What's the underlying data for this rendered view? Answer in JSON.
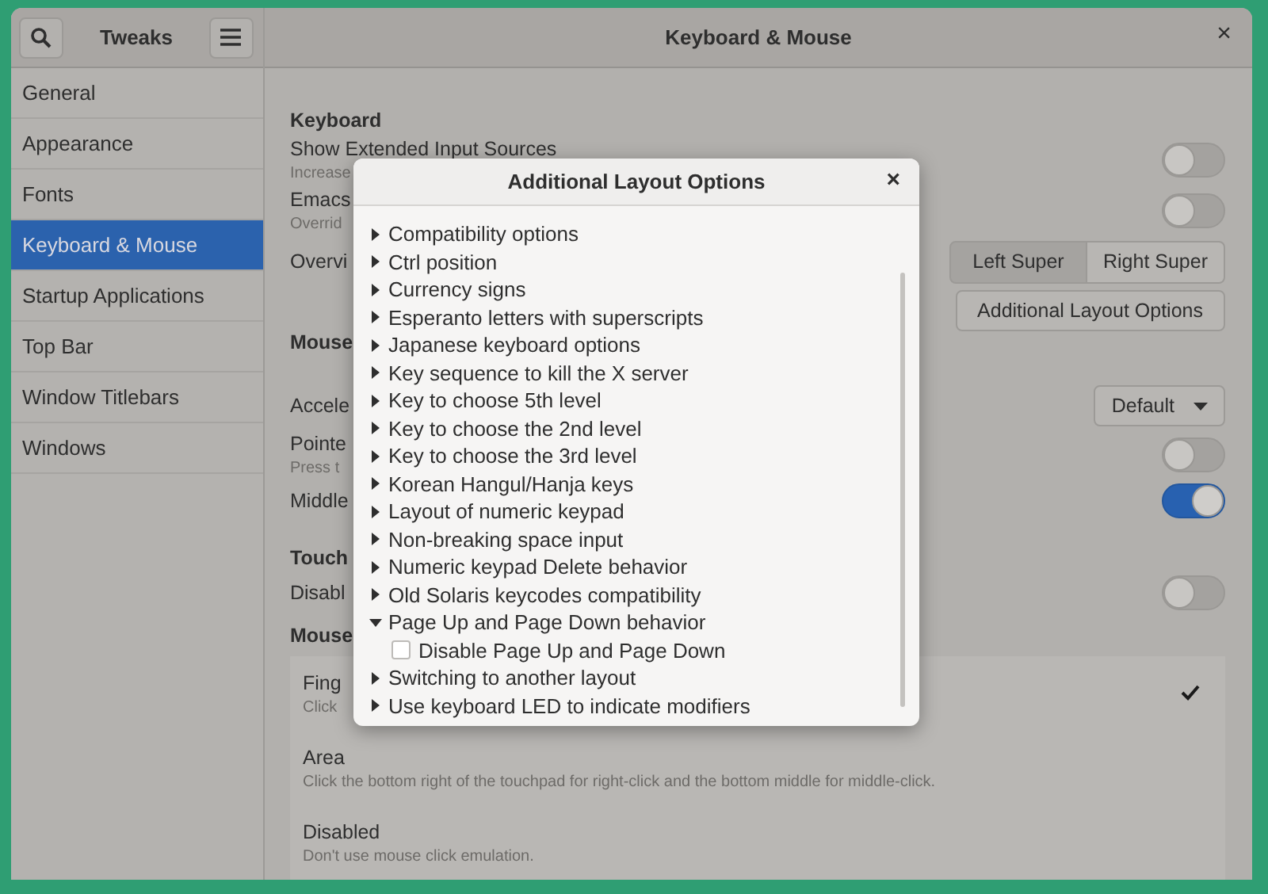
{
  "sidebar": {
    "title": "Tweaks",
    "items": [
      {
        "label": "General",
        "selected": false
      },
      {
        "label": "Appearance",
        "selected": false
      },
      {
        "label": "Fonts",
        "selected": false
      },
      {
        "label": "Keyboard & Mouse",
        "selected": true
      },
      {
        "label": "Startup Applications",
        "selected": false
      },
      {
        "label": "Top Bar",
        "selected": false
      },
      {
        "label": "Window Titlebars",
        "selected": false
      },
      {
        "label": "Windows",
        "selected": false
      }
    ]
  },
  "window": {
    "title": "Keyboard & Mouse",
    "close": "×"
  },
  "content": [
    {
      "kind": "heading",
      "label": "Keyboard"
    },
    {
      "kind": "toggle",
      "label": "Show Extended Input Sources",
      "description": "Increase",
      "on": false
    },
    {
      "kind": "toggle",
      "label": "Emacs",
      "description": "Overrid",
      "on": false
    },
    {
      "kind": "segmented",
      "label": "Overvi",
      "options": [
        {
          "label": "Left Super",
          "selected": true
        },
        {
          "label": "Right Super",
          "selected": false
        }
      ],
      "button": "Additional Layout Options"
    },
    {
      "kind": "heading",
      "label": "Mouse"
    },
    {
      "kind": "dropdown",
      "label": "Accele",
      "value": "Default"
    },
    {
      "kind": "toggle",
      "label": "Pointe",
      "description": "Press t",
      "on": false
    },
    {
      "kind": "toggle",
      "label": "Middle",
      "on": true
    },
    {
      "kind": "heading",
      "label": "Touch"
    },
    {
      "kind": "toggle",
      "label": "Disabl",
      "on": false
    },
    {
      "kind": "heading",
      "label": "Mouse"
    },
    {
      "kind": "list",
      "options": [
        {
          "title": "Fing",
          "description": "Click",
          "selected": true
        },
        {
          "title": "Area",
          "description": "Click the bottom right of the touchpad for right-click and the bottom middle for middle-click.",
          "selected": false
        },
        {
          "title": "Disabled",
          "description": "Don't use mouse click emulation.",
          "selected": false
        }
      ]
    }
  ],
  "dialog": {
    "title": "Additional Layout Options",
    "close": "×",
    "items": [
      {
        "label": "Compatibility options",
        "expanded": false
      },
      {
        "label": "Ctrl position",
        "expanded": false
      },
      {
        "label": "Currency signs",
        "expanded": false
      },
      {
        "label": "Esperanto letters with superscripts",
        "expanded": false
      },
      {
        "label": "Japanese keyboard options",
        "expanded": false
      },
      {
        "label": "Key sequence to kill the X server",
        "expanded": false
      },
      {
        "label": "Key to choose 5th level",
        "expanded": false
      },
      {
        "label": "Key to choose the 2nd level",
        "expanded": false
      },
      {
        "label": "Key to choose the 3rd level",
        "expanded": false
      },
      {
        "label": "Korean Hangul/Hanja keys",
        "expanded": false
      },
      {
        "label": "Layout of numeric keypad",
        "expanded": false
      },
      {
        "label": "Non-breaking space input",
        "expanded": false
      },
      {
        "label": "Numeric keypad Delete behavior",
        "expanded": false
      },
      {
        "label": "Old Solaris keycodes compatibility",
        "expanded": false
      },
      {
        "label": "Page Up and Page Down behavior",
        "expanded": true,
        "children": [
          {
            "label": "Disable Page Up and Page Down",
            "checked": false
          }
        ]
      },
      {
        "label": "Switching to another layout",
        "expanded": false
      },
      {
        "label": "Use keyboard LED to indicate modifiers",
        "expanded": false
      }
    ]
  }
}
